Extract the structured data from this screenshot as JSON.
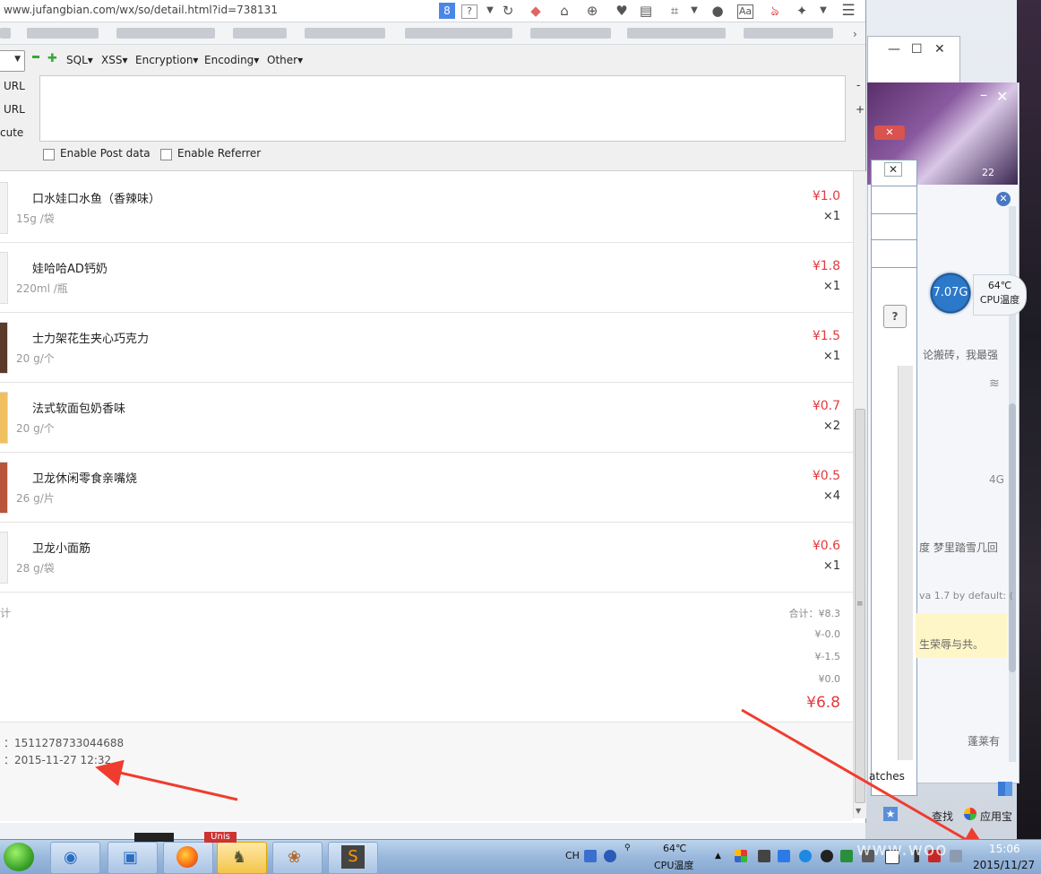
{
  "browser": {
    "url": "www.jufangbian.com/wx/so/detail.html?id=738131"
  },
  "hackbar": {
    "menus": [
      "SQL▾",
      "XSS▾",
      "Encryption▾",
      "Encoding▾",
      "Other▾"
    ],
    "side_labels": [
      "URL",
      "URL",
      "cute"
    ],
    "minus": "-",
    "plus": "+",
    "enable_post": "Enable Post data",
    "enable_referrer": "Enable Referrer"
  },
  "order": {
    "items": [
      {
        "name": "口水娃口水鱼（香辣味）",
        "spec": "15g /袋",
        "price": "¥1.0",
        "qty": "×1"
      },
      {
        "name": "娃哈哈AD钙奶",
        "spec": "220ml /瓶",
        "price": "¥1.8",
        "qty": "×1"
      },
      {
        "name": "士力架花生夹心巧克力",
        "spec": "20 g/个",
        "price": "¥1.5",
        "qty": "×1"
      },
      {
        "name": "法式软面包奶香味",
        "spec": "20 g/个",
        "price": "¥0.7",
        "qty": "×2"
      },
      {
        "name": "卫龙休闲零食亲嘴烧",
        "spec": "26 g/片",
        "price": "¥0.5",
        "qty": "×4"
      },
      {
        "name": "卫龙小面筋",
        "spec": "28 g/袋",
        "price": "¥0.6",
        "qty": "×1"
      }
    ],
    "summary_left": "计",
    "total_line": "合计：¥8.3",
    "discount1": "¥-0.0",
    "discount2": "¥-1.5",
    "shipping": "¥0.0",
    "grand_total": "¥6.8",
    "order_no_line": "：1511278733044688",
    "order_time_line": "：2015-11-27 12:32"
  },
  "background": {
    "cpu_value": "7.07G",
    "cpu_temp": "64℃",
    "cpu_label": "CPU温度",
    "sidebar_texts": [
      "论搬砖，我最强",
      "4G",
      "度 梦里踏雪几回",
      "va 1.7 by default: (",
      "生荣辱与共。",
      "蓬莱有"
    ],
    "search_label": "查找",
    "app_label": "应用宝",
    "matches_label": "atches",
    "badge_22": "22"
  },
  "taskbar": {
    "lang": "CH",
    "tray_temp": "64℃",
    "tray_cpu_label": "CPU温度",
    "clock_time": "15:06",
    "clock_date": "2015/11/27",
    "watermark": "www.woo",
    "unis_label": "Unis"
  },
  "colors": {
    "price_red": "#e4393c",
    "arrow_red": "#f03c2e",
    "taskbar_blue": "#9ab8dc"
  }
}
